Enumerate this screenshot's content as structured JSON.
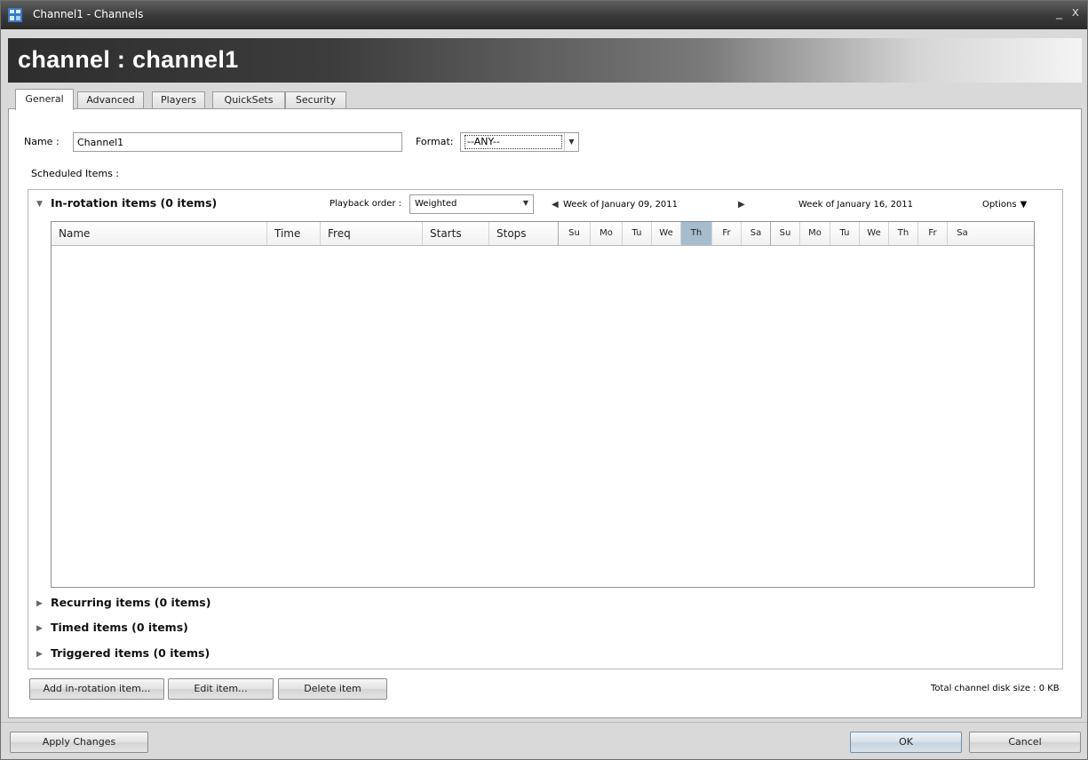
{
  "window": {
    "title": "Channel1 - Channels",
    "minimize_glyph": "_",
    "close_glyph": "x"
  },
  "banner": {
    "title": "channel : channel1"
  },
  "tabs": [
    {
      "label": "General",
      "active": true
    },
    {
      "label": "Advanced",
      "active": false
    },
    {
      "label": "Players",
      "active": false
    },
    {
      "label": "QuickSets",
      "active": false
    },
    {
      "label": "Security",
      "active": false
    }
  ],
  "general": {
    "name_label": "Name :",
    "name_value": "Channel1",
    "format_label": "Format:",
    "format_value": "--ANY--",
    "scheduled_label": "Scheduled Items :"
  },
  "rotation": {
    "title": "In-rotation items (0 items)",
    "playback_label": "Playback order :",
    "playback_value": "Weighted",
    "week1": "Week of January 09, 2011",
    "week2": "Week of January 16, 2011",
    "options_label": "Options",
    "columns": [
      "Name",
      "Time",
      "Freq",
      "Starts",
      "Stops"
    ],
    "days": [
      "Su",
      "Mo",
      "Tu",
      "We",
      "Th",
      "Fr",
      "Sa",
      "Su",
      "Mo",
      "Tu",
      "We",
      "Th",
      "Fr",
      "Sa"
    ],
    "today_index": 4
  },
  "sections": {
    "recurring": "Recurring items (0 items)",
    "timed": "Timed items (0 items)",
    "triggered": "Triggered items (0 items)"
  },
  "buttons": {
    "add": "Add in-rotation item...",
    "edit": "Edit item...",
    "delete": "Delete item",
    "apply": "Apply Changes",
    "ok": "OK",
    "cancel": "Cancel"
  },
  "disk_size": "Total channel disk size : 0 KB"
}
